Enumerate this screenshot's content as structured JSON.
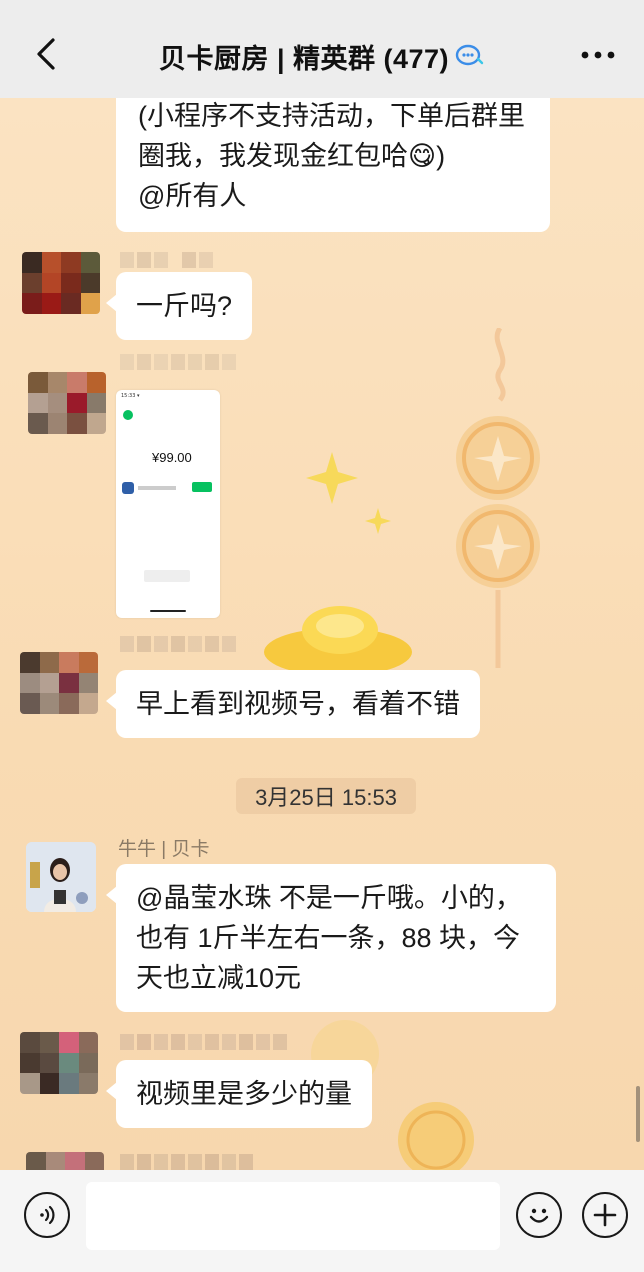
{
  "header": {
    "title": "贝卡厨房 | 精英群 (477)"
  },
  "messages": {
    "m1_text": "(小程序不支持活动，下单后群里圈我，我发现金红包哈😋)\n@所有人",
    "m2_text": "一斤吗?",
    "m3_image": {
      "price": "¥99.00"
    },
    "m4_text": "早上看到视频号，看着不错",
    "timestamp": "3月25日 15:53",
    "m5_sender": "牛牛 | 贝卡",
    "m5_text": "@晶莹水珠 不是一斤哦。小的，也有 1斤半左右一条，88 块，今天也立减10元",
    "m6_text": "视频里是多少的量"
  },
  "input": {
    "placeholder": ""
  },
  "colors": {
    "header_bg": "#ededed",
    "chat_bg": "#f9dbb3",
    "bubble": "#ffffff",
    "wechat_green": "#07c160"
  },
  "icons": {
    "back": "chevron-left-icon",
    "group": "group-chat-icon",
    "more": "more-dots-icon",
    "voice": "voice-icon",
    "emoji": "emoji-icon",
    "plus": "plus-icon"
  }
}
